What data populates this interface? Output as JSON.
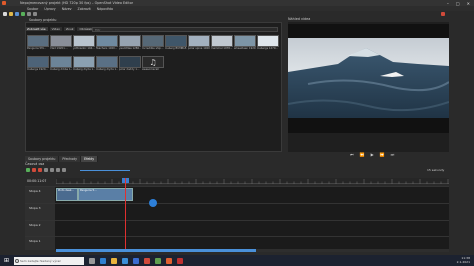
{
  "window": {
    "title": "Nepojmenovaný projekt (HD 720p 30 fps) – OpenShot Video Editor",
    "controls": [
      "–",
      "□",
      "✕"
    ]
  },
  "menu": [
    "Soubor",
    "Úpravy",
    "Název",
    "Zobrazit",
    "Nápověda"
  ],
  "files_panel": {
    "header": "Soubory projektu",
    "filters": [
      "Zobrazit vše",
      "Video",
      "Zvuk",
      "Obrázek"
    ],
    "active_filter": 0,
    "search_placeholder": "Filtr",
    "thumbs": [
      {
        "cap": "Penguins 5M...",
        "color": "#5a6e80"
      },
      {
        "cap": "Vlad 1920×...",
        "color": "#8a8f99"
      },
      {
        "cap": "yottowdoc 104...",
        "color": "#b8c3cd"
      },
      {
        "cap": "Teachers 1920...",
        "color": "#6f8aa0"
      },
      {
        "cap": "yeamMae 1280...",
        "color": "#96a3b0"
      },
      {
        "cap": "Incredible ship...",
        "color": "#566876"
      },
      {
        "cap": "Iceberg BUMBLE...",
        "color": "#3f5669"
      },
      {
        "cap": "polar spine 1920...",
        "color": "#a3b1bf"
      },
      {
        "cap": "mammal 1978...",
        "color": "#c0c8d0"
      },
      {
        "cap": "wheeldeen 1920...",
        "color": "#7d95a6"
      },
      {
        "cap": "Icebergs 1279...",
        "color": "#dfe6ec"
      },
      {
        "cap": "Icebergs 1920...",
        "color": "#4d6378"
      },
      {
        "cap": "Iceberg drbbe 1...",
        "color": "#6c8498"
      },
      {
        "cap": "Iceberg dlyda 1...",
        "color": "#8ba0b1"
      },
      {
        "cap": "Iceberg dlyda 1...",
        "color": "#5a7085"
      },
      {
        "cap": "polar daddy 1...",
        "color": "#2f3f4d"
      },
      {
        "cap": "awesomecall",
        "color": "#2a2a2a"
      }
    ]
  },
  "preview": {
    "header": "Náhled videa",
    "controls": [
      "⏮",
      "⏪",
      "▶",
      "⏩",
      "⏭"
    ]
  },
  "bottom_tabs": [
    "Soubory projektu",
    "Přechody",
    "Efekty"
  ],
  "active_bottom_tab": 2,
  "timeline": {
    "header": "Časová osa",
    "timecode": "00:00:11:07",
    "tracks": [
      "Stopa 4",
      "Stopa 3",
      "Stopa 2",
      "Stopa 1"
    ],
    "clips": [
      {
        "label": "Pinto desk...",
        "track": 0
      },
      {
        "label": "Penguins 5...",
        "track": 0
      }
    ],
    "zoom_label": "15 sekundy"
  },
  "taskbar": {
    "search_placeholder": "Sem zadejte hledaný výraz",
    "time": "11:38",
    "date": "2.1.2021"
  },
  "colors": {
    "accent": "#2d7fd8",
    "playhead": "#e03030",
    "clip": "#4b6b8f"
  }
}
